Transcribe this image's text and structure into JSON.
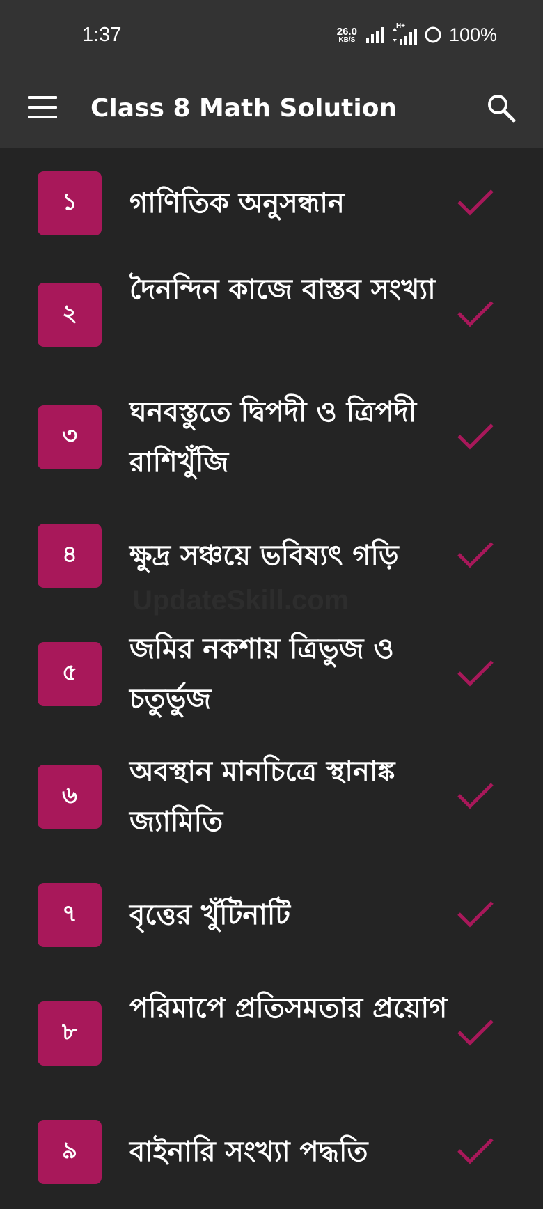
{
  "status_bar": {
    "time": "1:37",
    "net_speed_value": "26.0",
    "net_speed_unit": "KB/S",
    "network_type": "H+",
    "battery": "100%"
  },
  "app_bar": {
    "title": "Class 8 Math Solution",
    "menu_icon": "hamburger-menu-icon",
    "search_icon": "search-icon"
  },
  "colors": {
    "background": "#242424",
    "bar": "#333333",
    "badge": "#a8185a",
    "check": "#a8185a",
    "text": "#ffffff"
  },
  "chapters": [
    {
      "number": "১",
      "title": "গাণিতিক অনুসন্ধান"
    },
    {
      "number": "২",
      "title": " দৈনন্দিন কাজে বাস্তব সংখ্যা"
    },
    {
      "number": "৩",
      "title": "ঘনবস্তুতে দ্বিপদী ও ত্রিপদী রাশিখুঁজি"
    },
    {
      "number": "৪",
      "title": "ক্ষুদ্র সঞ্চয়ে ভবিষ্যৎ গড়ি"
    },
    {
      "number": "৫",
      "title": " জমির নকশায় ত্রিভুজ ও চতুর্ভুজ"
    },
    {
      "number": "৬",
      "title": "অবস্থান মানচিত্রে স্থানাঙ্ক জ্যামিতি"
    },
    {
      "number": "৭",
      "title": "বৃত্তের খুঁটিনাটি"
    },
    {
      "number": "৮",
      "title": "পরিমাপে প্রতিসমতার প্রয়োগ"
    },
    {
      "number": "৯",
      "title": "বাইনারি সংখ্যা পদ্ধতি"
    }
  ]
}
